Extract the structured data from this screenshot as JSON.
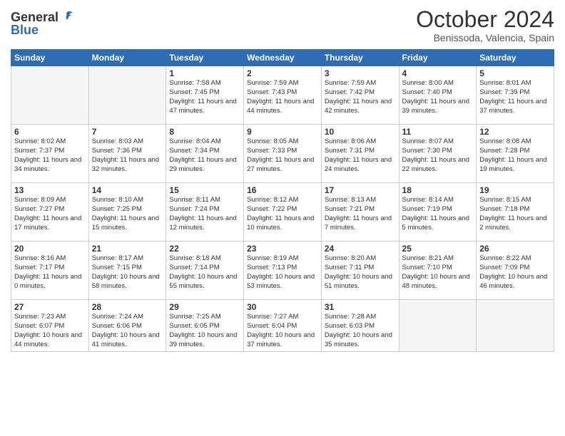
{
  "header": {
    "logo_general": "General",
    "logo_blue": "Blue",
    "title": "October 2024",
    "subtitle": "Benissoda, Valencia, Spain"
  },
  "days_of_week": [
    "Sunday",
    "Monday",
    "Tuesday",
    "Wednesday",
    "Thursday",
    "Friday",
    "Saturday"
  ],
  "weeks": [
    [
      {
        "day": "",
        "sunrise": "",
        "sunset": "",
        "daylight": "",
        "empty": true
      },
      {
        "day": "",
        "sunrise": "",
        "sunset": "",
        "daylight": "",
        "empty": true
      },
      {
        "day": "1",
        "sunrise": "Sunrise: 7:58 AM",
        "sunset": "Sunset: 7:45 PM",
        "daylight": "Daylight: 11 hours and 47 minutes.",
        "empty": false
      },
      {
        "day": "2",
        "sunrise": "Sunrise: 7:59 AM",
        "sunset": "Sunset: 7:43 PM",
        "daylight": "Daylight: 11 hours and 44 minutes.",
        "empty": false
      },
      {
        "day": "3",
        "sunrise": "Sunrise: 7:59 AM",
        "sunset": "Sunset: 7:42 PM",
        "daylight": "Daylight: 11 hours and 42 minutes.",
        "empty": false
      },
      {
        "day": "4",
        "sunrise": "Sunrise: 8:00 AM",
        "sunset": "Sunset: 7:40 PM",
        "daylight": "Daylight: 11 hours and 39 minutes.",
        "empty": false
      },
      {
        "day": "5",
        "sunrise": "Sunrise: 8:01 AM",
        "sunset": "Sunset: 7:39 PM",
        "daylight": "Daylight: 11 hours and 37 minutes.",
        "empty": false
      }
    ],
    [
      {
        "day": "6",
        "sunrise": "Sunrise: 8:02 AM",
        "sunset": "Sunset: 7:37 PM",
        "daylight": "Daylight: 11 hours and 34 minutes.",
        "empty": false
      },
      {
        "day": "7",
        "sunrise": "Sunrise: 8:03 AM",
        "sunset": "Sunset: 7:36 PM",
        "daylight": "Daylight: 11 hours and 32 minutes.",
        "empty": false
      },
      {
        "day": "8",
        "sunrise": "Sunrise: 8:04 AM",
        "sunset": "Sunset: 7:34 PM",
        "daylight": "Daylight: 11 hours and 29 minutes.",
        "empty": false
      },
      {
        "day": "9",
        "sunrise": "Sunrise: 8:05 AM",
        "sunset": "Sunset: 7:33 PM",
        "daylight": "Daylight: 11 hours and 27 minutes.",
        "empty": false
      },
      {
        "day": "10",
        "sunrise": "Sunrise: 8:06 AM",
        "sunset": "Sunset: 7:31 PM",
        "daylight": "Daylight: 11 hours and 24 minutes.",
        "empty": false
      },
      {
        "day": "11",
        "sunrise": "Sunrise: 8:07 AM",
        "sunset": "Sunset: 7:30 PM",
        "daylight": "Daylight: 11 hours and 22 minutes.",
        "empty": false
      },
      {
        "day": "12",
        "sunrise": "Sunrise: 8:08 AM",
        "sunset": "Sunset: 7:28 PM",
        "daylight": "Daylight: 11 hours and 19 minutes.",
        "empty": false
      }
    ],
    [
      {
        "day": "13",
        "sunrise": "Sunrise: 8:09 AM",
        "sunset": "Sunset: 7:27 PM",
        "daylight": "Daylight: 11 hours and 17 minutes.",
        "empty": false
      },
      {
        "day": "14",
        "sunrise": "Sunrise: 8:10 AM",
        "sunset": "Sunset: 7:25 PM",
        "daylight": "Daylight: 11 hours and 15 minutes.",
        "empty": false
      },
      {
        "day": "15",
        "sunrise": "Sunrise: 8:11 AM",
        "sunset": "Sunset: 7:24 PM",
        "daylight": "Daylight: 11 hours and 12 minutes.",
        "empty": false
      },
      {
        "day": "16",
        "sunrise": "Sunrise: 8:12 AM",
        "sunset": "Sunset: 7:22 PM",
        "daylight": "Daylight: 11 hours and 10 minutes.",
        "empty": false
      },
      {
        "day": "17",
        "sunrise": "Sunrise: 8:13 AM",
        "sunset": "Sunset: 7:21 PM",
        "daylight": "Daylight: 11 hours and 7 minutes.",
        "empty": false
      },
      {
        "day": "18",
        "sunrise": "Sunrise: 8:14 AM",
        "sunset": "Sunset: 7:19 PM",
        "daylight": "Daylight: 11 hours and 5 minutes.",
        "empty": false
      },
      {
        "day": "19",
        "sunrise": "Sunrise: 8:15 AM",
        "sunset": "Sunset: 7:18 PM",
        "daylight": "Daylight: 11 hours and 2 minutes.",
        "empty": false
      }
    ],
    [
      {
        "day": "20",
        "sunrise": "Sunrise: 8:16 AM",
        "sunset": "Sunset: 7:17 PM",
        "daylight": "Daylight: 11 hours and 0 minutes.",
        "empty": false
      },
      {
        "day": "21",
        "sunrise": "Sunrise: 8:17 AM",
        "sunset": "Sunset: 7:15 PM",
        "daylight": "Daylight: 10 hours and 58 minutes.",
        "empty": false
      },
      {
        "day": "22",
        "sunrise": "Sunrise: 8:18 AM",
        "sunset": "Sunset: 7:14 PM",
        "daylight": "Daylight: 10 hours and 55 minutes.",
        "empty": false
      },
      {
        "day": "23",
        "sunrise": "Sunrise: 8:19 AM",
        "sunset": "Sunset: 7:13 PM",
        "daylight": "Daylight: 10 hours and 53 minutes.",
        "empty": false
      },
      {
        "day": "24",
        "sunrise": "Sunrise: 8:20 AM",
        "sunset": "Sunset: 7:11 PM",
        "daylight": "Daylight: 10 hours and 51 minutes.",
        "empty": false
      },
      {
        "day": "25",
        "sunrise": "Sunrise: 8:21 AM",
        "sunset": "Sunset: 7:10 PM",
        "daylight": "Daylight: 10 hours and 48 minutes.",
        "empty": false
      },
      {
        "day": "26",
        "sunrise": "Sunrise: 8:22 AM",
        "sunset": "Sunset: 7:09 PM",
        "daylight": "Daylight: 10 hours and 46 minutes.",
        "empty": false
      }
    ],
    [
      {
        "day": "27",
        "sunrise": "Sunrise: 7:23 AM",
        "sunset": "Sunset: 6:07 PM",
        "daylight": "Daylight: 10 hours and 44 minutes.",
        "empty": false
      },
      {
        "day": "28",
        "sunrise": "Sunrise: 7:24 AM",
        "sunset": "Sunset: 6:06 PM",
        "daylight": "Daylight: 10 hours and 41 minutes.",
        "empty": false
      },
      {
        "day": "29",
        "sunrise": "Sunrise: 7:25 AM",
        "sunset": "Sunset: 6:05 PM",
        "daylight": "Daylight: 10 hours and 39 minutes.",
        "empty": false
      },
      {
        "day": "30",
        "sunrise": "Sunrise: 7:27 AM",
        "sunset": "Sunset: 6:04 PM",
        "daylight": "Daylight: 10 hours and 37 minutes.",
        "empty": false
      },
      {
        "day": "31",
        "sunrise": "Sunrise: 7:28 AM",
        "sunset": "Sunset: 6:03 PM",
        "daylight": "Daylight: 10 hours and 35 minutes.",
        "empty": false
      },
      {
        "day": "",
        "sunrise": "",
        "sunset": "",
        "daylight": "",
        "empty": true
      },
      {
        "day": "",
        "sunrise": "",
        "sunset": "",
        "daylight": "",
        "empty": true
      }
    ]
  ]
}
